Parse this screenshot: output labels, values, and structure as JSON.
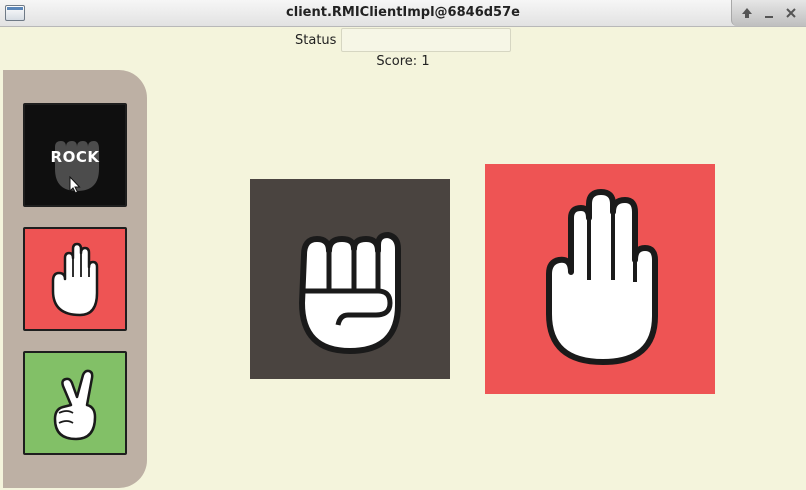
{
  "window": {
    "title": "client.RMIClientImpl@6846d57e",
    "controls": [
      "maximize",
      "minimize",
      "close"
    ]
  },
  "status": {
    "label": "Status",
    "value": ""
  },
  "score": "Score: 1",
  "choices": [
    {
      "id": "rock",
      "label": "ROCK",
      "icon": "fist-icon",
      "color": "#0f0f0f",
      "hovered": true
    },
    {
      "id": "paper",
      "label": "",
      "icon": "open-hand-icon",
      "color": "#ee5454",
      "hovered": false
    },
    {
      "id": "scissors",
      "label": "",
      "icon": "peace-hand-icon",
      "color": "#82c067",
      "hovered": false
    }
  ],
  "result": {
    "player": {
      "choice": "rock",
      "icon": "fist-icon",
      "color": "#4a4440"
    },
    "opponent": {
      "choice": "paper",
      "icon": "open-hand-icon",
      "color": "#ee5454"
    }
  },
  "colors": {
    "background": "#f4f4dc",
    "sidebar": "#bdb0a4"
  }
}
